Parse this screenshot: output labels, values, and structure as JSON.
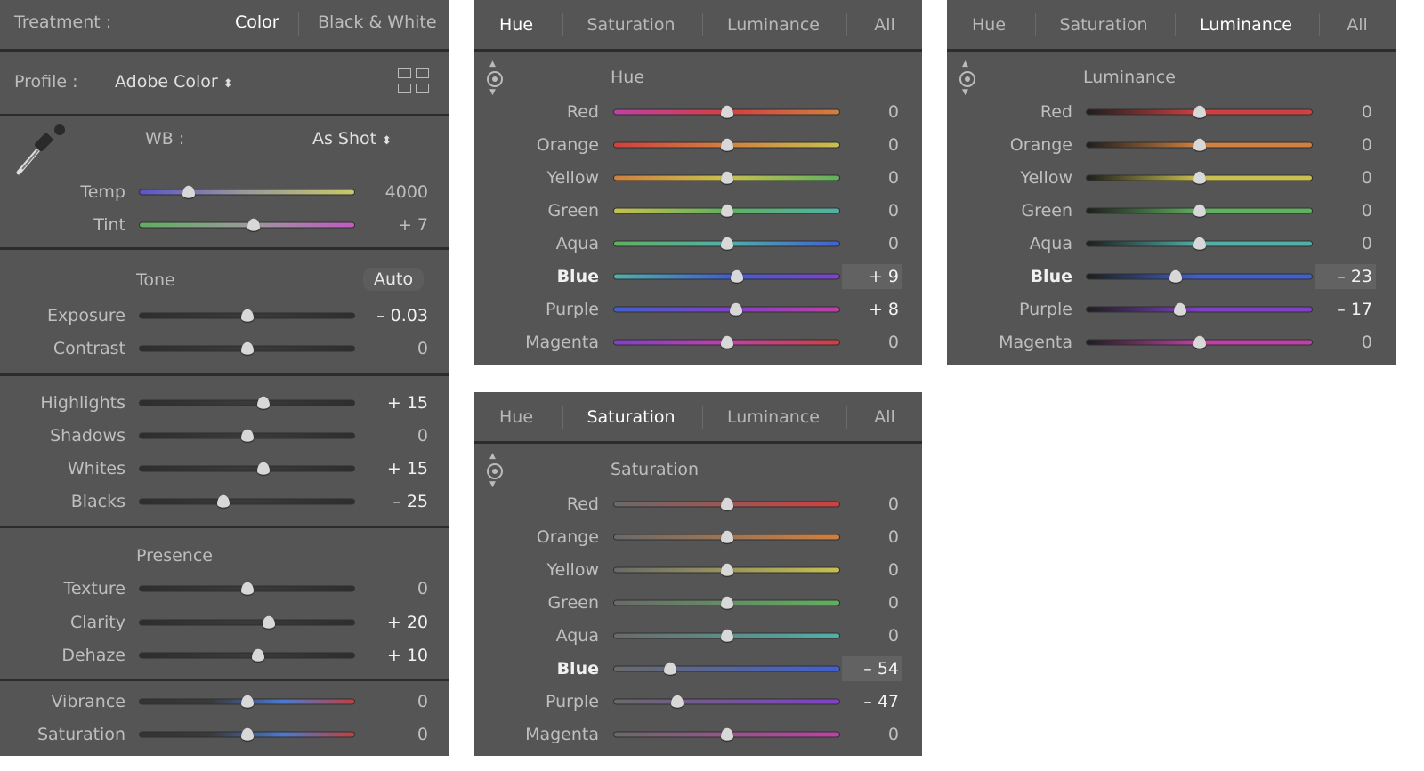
{
  "basic": {
    "treatment_label": "Treatment :",
    "treatment_options": [
      "Color",
      "Black & White"
    ],
    "treatment_selected": "Color",
    "profile_label": "Profile :",
    "profile_value": "Adobe Color",
    "wb_label": "WB :",
    "wb_value": "As Shot",
    "tone_label": "Tone",
    "auto_label": "Auto",
    "presence_label": "Presence",
    "sliders": [
      {
        "label": "Temp",
        "value": "4000",
        "pos": 0.23,
        "muted": true,
        "colors": [
          "#5a55c8",
          "#9a9a9a",
          "#c8c86a"
        ]
      },
      {
        "label": "Tint",
        "value": "+ 7",
        "pos": 0.53,
        "muted": true,
        "colors": [
          "#5fae5f",
          "#9a9a9a",
          "#c05ac0"
        ]
      },
      {
        "label": "Exposure",
        "value": "– 0.03",
        "pos": 0.5
      },
      {
        "label": "Contrast",
        "value": "0",
        "pos": 0.5
      },
      {
        "label": "Highlights",
        "value": "+ 15",
        "pos": 0.575
      },
      {
        "label": "Shadows",
        "value": "0",
        "pos": 0.5
      },
      {
        "label": "Whites",
        "value": "+ 15",
        "pos": 0.575
      },
      {
        "label": "Blacks",
        "value": "– 25",
        "pos": 0.39
      },
      {
        "label": "Texture",
        "value": "0",
        "pos": 0.5
      },
      {
        "label": "Clarity",
        "value": "+ 20",
        "pos": 0.6
      },
      {
        "label": "Dehaze",
        "value": "+ 10",
        "pos": 0.55
      },
      {
        "label": "Vibrance",
        "value": "0",
        "pos": 0.5,
        "colors": [
          "#333",
          "#3a3a3a",
          "#4a7ad0",
          "#c04040"
        ]
      },
      {
        "label": "Saturation",
        "value": "0",
        "pos": 0.5,
        "colors": [
          "#333",
          "#3a3a3a",
          "#4a7ad0",
          "#c04040"
        ]
      }
    ]
  },
  "hsl_tabs": [
    "Hue",
    "Saturation",
    "Luminance",
    "All"
  ],
  "hsl_panels": [
    {
      "active": "Hue",
      "title": "Hue",
      "mode": "hue",
      "rows": [
        {
          "label": "Red",
          "value": "0",
          "pos": 0.5
        },
        {
          "label": "Orange",
          "value": "0",
          "pos": 0.5
        },
        {
          "label": "Yellow",
          "value": "0",
          "pos": 0.5
        },
        {
          "label": "Green",
          "value": "0",
          "pos": 0.5
        },
        {
          "label": "Aqua",
          "value": "0",
          "pos": 0.5
        },
        {
          "label": "Blue",
          "value": "+ 9",
          "pos": 0.545,
          "selected": true
        },
        {
          "label": "Purple",
          "value": "+ 8",
          "pos": 0.54
        },
        {
          "label": "Magenta",
          "value": "0",
          "pos": 0.5
        }
      ]
    },
    {
      "active": "Luminance",
      "title": "Luminance",
      "mode": "lum",
      "rows": [
        {
          "label": "Red",
          "value": "0",
          "pos": 0.5
        },
        {
          "label": "Orange",
          "value": "0",
          "pos": 0.5
        },
        {
          "label": "Yellow",
          "value": "0",
          "pos": 0.5
        },
        {
          "label": "Green",
          "value": "0",
          "pos": 0.5
        },
        {
          "label": "Aqua",
          "value": "0",
          "pos": 0.5
        },
        {
          "label": "Blue",
          "value": "– 23",
          "pos": 0.395,
          "selected": true
        },
        {
          "label": "Purple",
          "value": "– 17",
          "pos": 0.415
        },
        {
          "label": "Magenta",
          "value": "0",
          "pos": 0.5
        }
      ]
    },
    {
      "active": "Saturation",
      "title": "Saturation",
      "mode": "sat",
      "rows": [
        {
          "label": "Red",
          "value": "0",
          "pos": 0.5
        },
        {
          "label": "Orange",
          "value": "0",
          "pos": 0.5
        },
        {
          "label": "Yellow",
          "value": "0",
          "pos": 0.5
        },
        {
          "label": "Green",
          "value": "0",
          "pos": 0.5
        },
        {
          "label": "Aqua",
          "value": "0",
          "pos": 0.5
        },
        {
          "label": "Blue",
          "value": "– 54",
          "pos": 0.25,
          "selected": true
        },
        {
          "label": "Purple",
          "value": "– 47",
          "pos": 0.28
        },
        {
          "label": "Magenta",
          "value": "0",
          "pos": 0.5
        }
      ]
    }
  ],
  "hue_colors": {
    "Red": "#d04040",
    "Orange": "#d08040",
    "Yellow": "#c8c050",
    "Green": "#60b060",
    "Aqua": "#50b0a8",
    "Blue": "#4060d0",
    "Purple": "#8040c8",
    "Magenta": "#c040a8"
  }
}
